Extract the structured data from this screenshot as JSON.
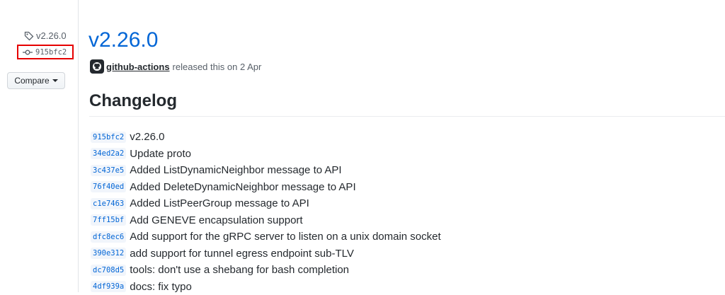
{
  "sidebar": {
    "tag": "v2.26.0",
    "commit": "915bfc2",
    "compare_label": "Compare"
  },
  "release": {
    "title": "v2.26.0",
    "author": "github-actions",
    "released_text": "released this on 2 Apr"
  },
  "changelog": {
    "heading": "Changelog",
    "commits": [
      {
        "sha": "915bfc2",
        "message": "v2.26.0"
      },
      {
        "sha": "34ed2a2",
        "message": "Update proto"
      },
      {
        "sha": "3c437e5",
        "message": "Added ListDynamicNeighbor message to API"
      },
      {
        "sha": "76f40ed",
        "message": "Added DeleteDynamicNeighbor message to API"
      },
      {
        "sha": "c1e7463",
        "message": "Added ListPeerGroup message to API"
      },
      {
        "sha": "7ff15bf",
        "message": "Add GENEVE encapsulation support"
      },
      {
        "sha": "dfc8ec6",
        "message": "Add support for the gRPC server to listen on a unix domain socket"
      },
      {
        "sha": "390e312",
        "message": "add support for tunnel egress endpoint sub-TLV"
      },
      {
        "sha": "dc708d5",
        "message": "tools: don't use a shebang for bash completion"
      },
      {
        "sha": "4df939a",
        "message": "docs: fix typo"
      }
    ]
  },
  "colors": {
    "link": "#0366d6",
    "highlight_box": "#e60000"
  },
  "icons": [
    "tag-icon",
    "git-commit-icon",
    "github-mark-icon",
    "caret-down-icon"
  ]
}
